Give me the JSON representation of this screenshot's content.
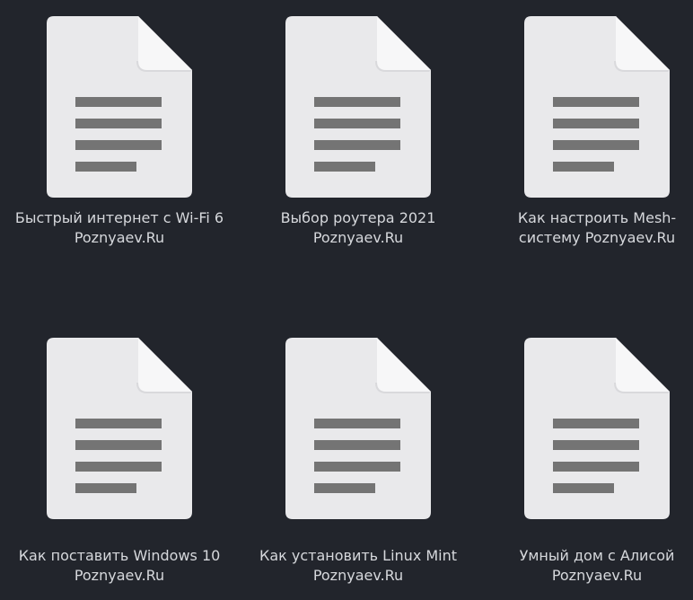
{
  "files": [
    {
      "line1": "Быстрый интернет с Wi-Fi 6",
      "line2": "Poznyaev.Ru",
      "icon": "text-document-icon"
    },
    {
      "line1": "Выбор роутера 2021",
      "line2": "Poznyaev.Ru",
      "icon": "text-document-icon"
    },
    {
      "line1": "Как настроить Mesh-",
      "line2": "систему Poznyaev.Ru",
      "icon": "text-document-icon"
    },
    {
      "line1": "Как поставить Windows 10",
      "line2": "Poznyaev.Ru",
      "icon": "text-document-icon"
    },
    {
      "line1": "Как установить Linux Mint",
      "line2": "Poznyaev.Ru",
      "icon": "text-document-icon"
    },
    {
      "line1": "Умный дом с Алисой",
      "line2": "Poznyaev.Ru",
      "icon": "text-document-icon"
    }
  ],
  "colors": {
    "background": "#22252c",
    "document": "#e9e9eb",
    "fold": "#f7f7f8",
    "lines": "#747474",
    "label": "#d6d8dc"
  }
}
